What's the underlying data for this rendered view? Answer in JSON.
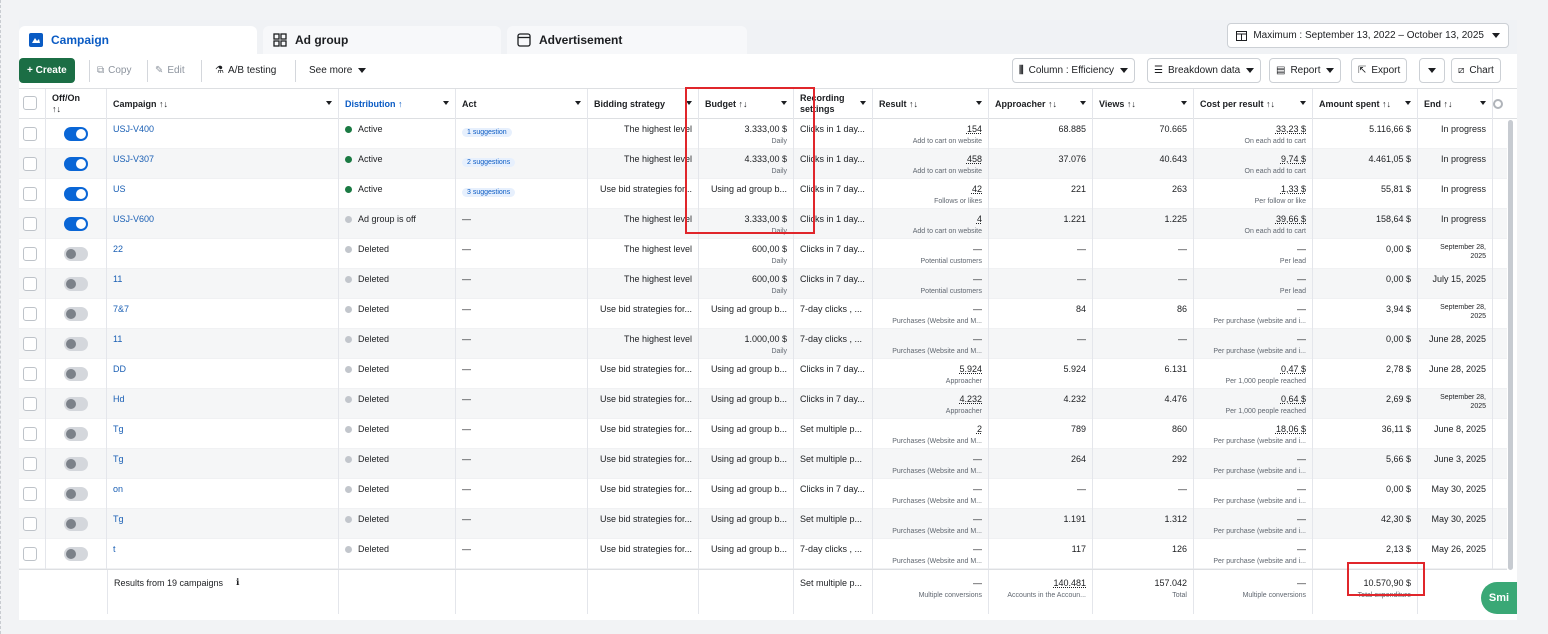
{
  "tabs": [
    {
      "label": "Campaign",
      "icon": "flag-icon"
    },
    {
      "label": "Ad group",
      "icon": "grid-icon"
    },
    {
      "label": "Advertisement",
      "icon": "window-icon"
    }
  ],
  "date_range": "Maximum : September 13, 2022 – October 13, 2025",
  "toolbar": {
    "create": "+ Create",
    "copy": "Copy",
    "edit": "Edit",
    "ab_testing": "A/B testing",
    "see_more": "See more",
    "column": "Column : Efficiency",
    "breakdown": "Breakdown data",
    "report": "Report",
    "export": "Export",
    "chart": "Chart"
  },
  "columns": {
    "onoff": "Off/On ↑↓",
    "campaign": "Campaign ↑↓",
    "distribution": "Distribution ↑",
    "act": "Act",
    "bidding": "Bidding strategy",
    "budget": "Budget ↑↓",
    "recording": "Recording settings",
    "result": "Result ↑↓",
    "approacher": "Approacher ↑↓",
    "views": "Views ↑↓",
    "cpr": "Cost per result ↑↓",
    "spent": "Amount spent ↑↓",
    "end": "End ↑↓"
  },
  "rows": [
    {
      "on": true,
      "campaign": "USJ-V400",
      "status": "Active",
      "status_type": "active",
      "act": "1 suggestion",
      "bidding": "The highest level",
      "budget": "3.333,00 $",
      "budget_sub": "Daily",
      "recording": "Clicks in 1 day...",
      "result": "154",
      "result_sub": "Add to cart on website",
      "approacher": "68.885",
      "views": "70.665",
      "cpr": "33,23 $",
      "cpr_sub": "On each add to cart",
      "spent": "5.116,66 $",
      "end": "In progress"
    },
    {
      "on": true,
      "campaign": "USJ-V307",
      "status": "Active",
      "status_type": "active",
      "act": "2 suggestions",
      "bidding": "The highest level",
      "budget": "4.333,00 $",
      "budget_sub": "Daily",
      "recording": "Clicks in 1 day...",
      "result": "458",
      "result_sub": "Add to cart on website",
      "approacher": "37.076",
      "views": "40.643",
      "cpr": "9,74 $",
      "cpr_sub": "On each add to cart",
      "spent": "4.461,05 $",
      "end": "In progress"
    },
    {
      "on": true,
      "campaign": "US",
      "status": "Active",
      "status_type": "active",
      "act": "3 suggestions",
      "bidding": "Use bid strategies for...",
      "budget": "Using ad group b...",
      "budget_sub": "",
      "recording": "Clicks in 7 day...",
      "result": "42",
      "result_sub": "Follows or likes",
      "approacher": "221",
      "views": "263",
      "cpr": "1,33 $",
      "cpr_sub": "Per follow or like",
      "spent": "55,81 $",
      "end": "In progress"
    },
    {
      "on": true,
      "campaign": "USJ-V600",
      "status": "Ad group is off",
      "status_type": "off",
      "act": "—",
      "bidding": "The highest level",
      "budget": "3.333,00 $",
      "budget_sub": "Daily",
      "recording": "Clicks in 1 day...",
      "result": "4",
      "result_sub": "Add to cart on website",
      "approacher": "1.221",
      "views": "1.225",
      "cpr": "39,66 $",
      "cpr_sub": "On each add to cart",
      "spent": "158,64 $",
      "end": "In progress"
    },
    {
      "on": false,
      "campaign": "22",
      "status": "Deleted",
      "status_type": "off",
      "act": "—",
      "bidding": "The highest level",
      "budget": "600,00 $",
      "budget_sub": "Daily",
      "recording": "Clicks in 7 day...",
      "result": "—",
      "result_sub": "Potential customers",
      "approacher": "—",
      "views": "—",
      "cpr": "—",
      "cpr_sub": "Per lead",
      "spent": "0,00 $",
      "end": "September 28, 2025"
    },
    {
      "on": false,
      "campaign": "11",
      "status": "Deleted",
      "status_type": "off",
      "act": "—",
      "bidding": "The highest level",
      "budget": "600,00 $",
      "budget_sub": "Daily",
      "recording": "Clicks in 7 day...",
      "result": "—",
      "result_sub": "Potential customers",
      "approacher": "—",
      "views": "—",
      "cpr": "—",
      "cpr_sub": "Per lead",
      "spent": "0,00 $",
      "end": "July 15, 2025"
    },
    {
      "on": false,
      "campaign": "7&7",
      "status": "Deleted",
      "status_type": "off",
      "act": "—",
      "bidding": "Use bid strategies for...",
      "budget": "Using ad group b...",
      "budget_sub": "",
      "recording": "7-day clicks , ...",
      "result": "—",
      "result_sub": "Purchases (Website and M...",
      "approacher": "84",
      "views": "86",
      "cpr": "—",
      "cpr_sub": "Per purchase (website and i...",
      "spent": "3,94 $",
      "end": "September 28, 2025"
    },
    {
      "on": false,
      "campaign": "11",
      "status": "Deleted",
      "status_type": "off",
      "act": "—",
      "bidding": "The highest level",
      "budget": "1.000,00 $",
      "budget_sub": "Daily",
      "recording": "7-day clicks , ...",
      "result": "—",
      "result_sub": "Purchases (Website and M...",
      "approacher": "—",
      "views": "—",
      "cpr": "—",
      "cpr_sub": "Per purchase (website and i...",
      "spent": "0,00 $",
      "end": "June 28, 2025"
    },
    {
      "on": false,
      "campaign": "DD",
      "status": "Deleted",
      "status_type": "off",
      "act": "—",
      "bidding": "Use bid strategies for...",
      "budget": "Using ad group b...",
      "budget_sub": "",
      "recording": "Clicks in 7 day...",
      "result": "5.924",
      "result_sub": "Approacher",
      "approacher": "5.924",
      "views": "6.131",
      "cpr": "0,47 $",
      "cpr_sub": "Per 1,000 people reached",
      "spent": "2,78 $",
      "end": "June 28, 2025"
    },
    {
      "on": false,
      "campaign": "Hd",
      "status": "Deleted",
      "status_type": "off",
      "act": "—",
      "bidding": "Use bid strategies for...",
      "budget": "Using ad group b...",
      "budget_sub": "",
      "recording": "Clicks in 7 day...",
      "result": "4.232",
      "result_sub": "Approacher",
      "approacher": "4.232",
      "views": "4.476",
      "cpr": "0,64 $",
      "cpr_sub": "Per 1,000 people reached",
      "spent": "2,69 $",
      "end": "September 28, 2025"
    },
    {
      "on": false,
      "campaign": "Tg",
      "status": "Deleted",
      "status_type": "off",
      "act": "—",
      "bidding": "Use bid strategies for...",
      "budget": "Using ad group b...",
      "budget_sub": "",
      "recording": "Set multiple p...",
      "result": "2",
      "result_sub": "Purchases (Website and M...",
      "approacher": "789",
      "views": "860",
      "cpr": "18,06 $",
      "cpr_sub": "Per purchase (website and i...",
      "spent": "36,11 $",
      "end": "June 8, 2025"
    },
    {
      "on": false,
      "campaign": "Tg",
      "status": "Deleted",
      "status_type": "off",
      "act": "—",
      "bidding": "Use bid strategies for...",
      "budget": "Using ad group b...",
      "budget_sub": "",
      "recording": "Set multiple p...",
      "result": "—",
      "result_sub": "Purchases (Website and M...",
      "approacher": "264",
      "views": "292",
      "cpr": "—",
      "cpr_sub": "Per purchase (website and i...",
      "spent": "5,66 $",
      "end": "June 3, 2025"
    },
    {
      "on": false,
      "campaign": "on",
      "status": "Deleted",
      "status_type": "off",
      "act": "—",
      "bidding": "Use bid strategies for...",
      "budget": "Using ad group b...",
      "budget_sub": "",
      "recording": "Clicks in 7 day...",
      "result": "—",
      "result_sub": "Purchases (Website and M...",
      "approacher": "—",
      "views": "—",
      "cpr": "—",
      "cpr_sub": "Per purchase (website and i...",
      "spent": "0,00 $",
      "end": "May 30, 2025"
    },
    {
      "on": false,
      "campaign": "Tg",
      "status": "Deleted",
      "status_type": "off",
      "act": "—",
      "bidding": "Use bid strategies for...",
      "budget": "Using ad group b...",
      "budget_sub": "",
      "recording": "Set multiple p...",
      "result": "—",
      "result_sub": "Purchases (Website and M...",
      "approacher": "1.191",
      "views": "1.312",
      "cpr": "—",
      "cpr_sub": "Per purchase (website and i...",
      "spent": "42,30 $",
      "end": "May 30, 2025"
    },
    {
      "on": false,
      "campaign": "t",
      "status": "Deleted",
      "status_type": "off",
      "act": "—",
      "bidding": "Use bid strategies for...",
      "budget": "Using ad group b...",
      "budget_sub": "",
      "recording": "7-day clicks , ...",
      "result": "—",
      "result_sub": "Purchases (Website and M...",
      "approacher": "117",
      "views": "126",
      "cpr": "—",
      "cpr_sub": "Per purchase (website and i...",
      "spent": "2,13 $",
      "end": "May 26, 2025"
    }
  ],
  "footer": {
    "label": "Results from 19 campaigns",
    "recording": "Set multiple p...",
    "result": "—",
    "result_sub": "Multiple conversions",
    "approacher": "140.481",
    "approacher_sub": "Accounts in the Accoun...",
    "views": "157.042",
    "views_sub": "Total",
    "cpr": "—",
    "cpr_sub": "Multiple conversions",
    "spent": "10.570,90 $",
    "spent_sub": "Total expenditure"
  },
  "badge": "Smi",
  "colors": {
    "accent": "#0a66d6",
    "create": "#1b6e45",
    "highlight": "#e0262b"
  }
}
